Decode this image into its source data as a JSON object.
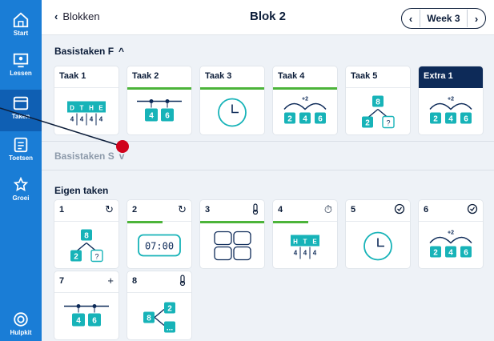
{
  "sidebar": {
    "items": [
      {
        "label": "Start",
        "icon": "home-icon"
      },
      {
        "label": "Lessen",
        "icon": "lessons-icon"
      },
      {
        "label": "Taken",
        "icon": "tasks-icon"
      },
      {
        "label": "Toetsen",
        "icon": "tests-icon"
      },
      {
        "label": "Groei",
        "icon": "growth-icon"
      }
    ],
    "help": {
      "label": "Hulpkit",
      "icon": "lifebuoy-icon"
    }
  },
  "header": {
    "back_label": "Blokken",
    "title": "Blok 2",
    "week_label": "Week 3"
  },
  "sections": {
    "f": {
      "title": "Basistaken F",
      "caret": "^"
    },
    "s": {
      "title": "Basistaken S",
      "caret": "v"
    },
    "eigen": {
      "title": "Eigen taken"
    }
  },
  "basis_f_cards": [
    {
      "title": "Taak 1",
      "illustration": "place-value-table-icon",
      "table_headers": [
        "D",
        "T",
        "H",
        "E"
      ],
      "table_values": [
        "4",
        "4",
        "4",
        "4"
      ]
    },
    {
      "title": "Taak 2",
      "illustration": "number-line-icon",
      "values": [
        "4",
        "6"
      ],
      "progress": 1
    },
    {
      "title": "Taak 3",
      "illustration": "clock-icon",
      "progress": 1
    },
    {
      "title": "Taak 4",
      "illustration": "number-jump-icon",
      "jump": "+2",
      "values": [
        "2",
        "4",
        "6"
      ],
      "progress": 1
    },
    {
      "title": "Taak 5",
      "illustration": "split-tree-icon",
      "values": [
        "8",
        "2",
        "?"
      ]
    },
    {
      "title": "Extra 1",
      "illustration": "number-jump-icon",
      "jump": "+2",
      "values": [
        "2",
        "4",
        "6"
      ],
      "highlight": true
    }
  ],
  "eigen_cards": [
    {
      "title": "1",
      "icon": "repeat-icon",
      "illustration": "split-tree-icon",
      "values": [
        "8",
        "2",
        "?"
      ]
    },
    {
      "title": "2",
      "icon": "repeat-icon",
      "illustration": "digital-clock-icon",
      "time": "07:00",
      "progress": 0.55
    },
    {
      "title": "3",
      "icon": "thermometer-icon",
      "illustration": "grid-icon",
      "progress": 1
    },
    {
      "title": "4",
      "icon": "timer-icon",
      "illustration": "place-value-table-icon",
      "table_headers": [
        "H",
        "T",
        "E"
      ],
      "table_values": [
        "4",
        "4",
        "4"
      ],
      "progress": 0.55
    },
    {
      "title": "5",
      "icon": "check-clock-icon",
      "illustration": "clock-icon"
    },
    {
      "title": "6",
      "icon": "check-clock-icon",
      "illustration": "number-jump-icon",
      "jump": "+2",
      "values": [
        "2",
        "4",
        "6"
      ]
    },
    {
      "title": "7",
      "icon": "plus-icon",
      "illustration": "number-line-icon",
      "values": [
        "4",
        "6"
      ]
    },
    {
      "title": "8",
      "icon": "thermometer-icon",
      "illustration": "branch-icon",
      "values": [
        "8",
        "2",
        "..."
      ]
    }
  ],
  "colors": {
    "sidebar": "#1a7dd6",
    "accent_teal": "#17b3b8",
    "navy": "#0d2a58",
    "progress_green": "#4cb43a",
    "pointer_red": "#d0021b"
  }
}
